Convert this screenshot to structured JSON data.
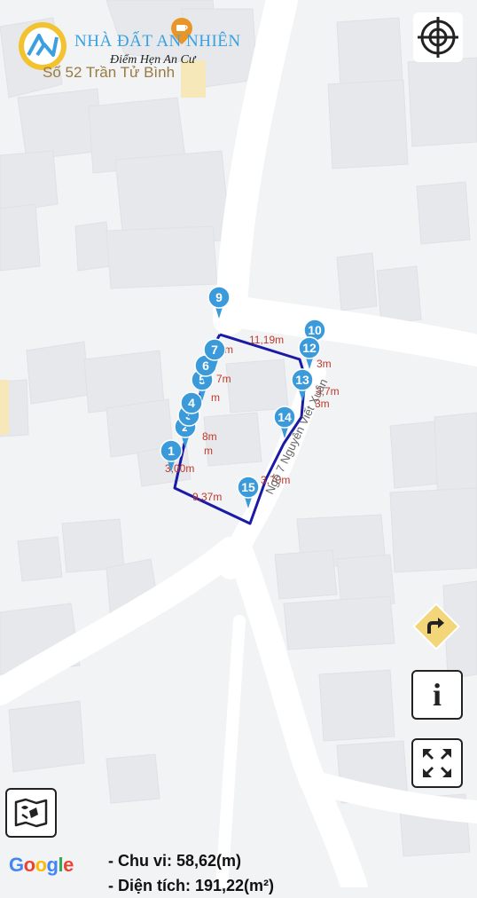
{
  "brand": {
    "name": "NHÀ ĐẤT AN NHIÊN",
    "slogan": "Điểm Hẹn An Cư",
    "color": "#3aa0e0"
  },
  "poi": {
    "label": "Số 52 Trần Tử Bình",
    "icon": "restaurant-pin-icon",
    "color": "#e8962a"
  },
  "street": {
    "name": "Ngõ 7 Nguyễn Viết Xuân"
  },
  "parcel": {
    "outline_color": "#1a1aa6",
    "marker_color": "#3b9ad9",
    "markers": [
      "1",
      "2",
      "3",
      "4",
      "5",
      "6",
      "7",
      "9",
      "10",
      "12",
      "13",
      "14",
      "15"
    ],
    "edge_labels": [
      "11,19m",
      "3,00m",
      "9,37m",
      "3,70m",
      "7m",
      "8m",
      "3m",
      "m",
      "m",
      "m",
      "3,7m",
      "3m"
    ]
  },
  "controls": {
    "locate_icon": "crosshair-icon",
    "directions_icon": "directions-arrow-icon",
    "info_label": "i",
    "fullscreen_icon": "fullscreen-icon",
    "layers_icon": "map-layers-icon"
  },
  "attribution": {
    "text": "Google"
  },
  "stats": {
    "perimeter": "- Chu vi: 58,62(m)",
    "area": "- Diện tích: 191,22(m²)"
  }
}
